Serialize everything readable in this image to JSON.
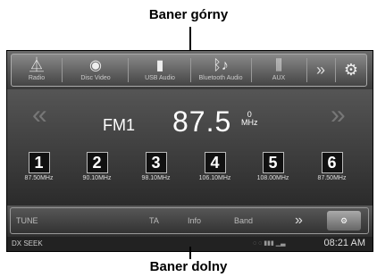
{
  "callouts": {
    "top": "Baner górny",
    "bottom": "Baner dolny"
  },
  "sources": [
    {
      "label": "Radio",
      "icon": "antenna-icon",
      "glyph": "⏅"
    },
    {
      "label": "Disc Video",
      "icon": "disc-icon",
      "glyph": "◉"
    },
    {
      "label": "USB Audio",
      "icon": "usb-icon",
      "glyph": "▮"
    },
    {
      "label": "Bluetooth Audio",
      "icon": "bluetooth-icon",
      "glyph": "ᛒ♪"
    },
    {
      "label": "AUX",
      "icon": "aux-icon",
      "glyph": "⫼"
    }
  ],
  "top_more": "»",
  "tuner": {
    "band": "FM1",
    "frequency": "87.5",
    "freq_decimal": "0",
    "unit": "MHz",
    "prev": "«",
    "next": "»"
  },
  "presets": [
    {
      "num": "1",
      "freq": "87.50MHz"
    },
    {
      "num": "2",
      "freq": "90.10MHz"
    },
    {
      "num": "3",
      "freq": "98.10MHz"
    },
    {
      "num": "4",
      "freq": "106.10MHz"
    },
    {
      "num": "5",
      "freq": "108.00MHz"
    },
    {
      "num": "6",
      "freq": "87.50MHz"
    }
  ],
  "bottom": {
    "tune": "TUNE",
    "ta": "TA",
    "info": "Info",
    "band": "Band",
    "more": "»"
  },
  "status": {
    "mode": "DX SEEK",
    "time": "08:21 AM"
  }
}
